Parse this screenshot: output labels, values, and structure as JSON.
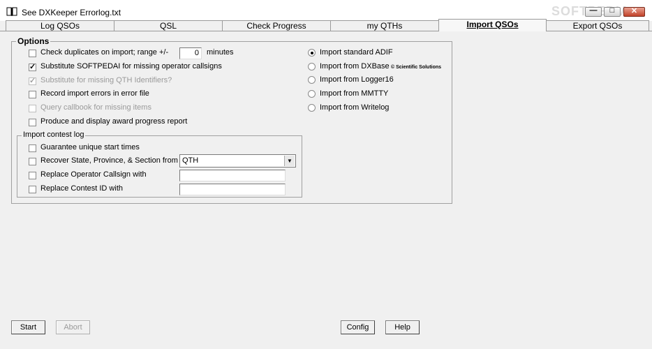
{
  "window": {
    "title": "See DXKeeper Errorlog.txt",
    "watermark": "SOFTPEDIA",
    "minimize_glyph": "—",
    "maximize_glyph": "□",
    "close_glyph": "✕"
  },
  "tabs": [
    {
      "label": "Log QSOs"
    },
    {
      "label": "QSL"
    },
    {
      "label": "Check Progress"
    },
    {
      "label": "my QTHs"
    },
    {
      "label": "Import QSOs",
      "active": true
    },
    {
      "label": "Export QSOs"
    }
  ],
  "options": {
    "legend": "Options",
    "check_duplicates": {
      "label": "Check duplicates on import; range +/-",
      "checked": false,
      "value": "0",
      "units": "minutes"
    },
    "substitute_callsign": {
      "label": "Substitute SOFTPEDAI for missing operator callsigns",
      "checked": true
    },
    "substitute_qth": {
      "label": "Substitute  for missing QTH Identifiers?",
      "checked": true,
      "disabled": true
    },
    "record_errors": {
      "label": "Record import errors in error file",
      "checked": false
    },
    "query_callbook": {
      "label": "Query callbook for missing items",
      "checked": false,
      "disabled": true
    },
    "award_progress": {
      "label": "Produce and display award progress report",
      "checked": false
    }
  },
  "import_formats": {
    "items": [
      {
        "label": "Import standard ADIF",
        "selected": true
      },
      {
        "label": "Import from DXBase",
        "selected": false
      },
      {
        "label": "Import from Logger16",
        "selected": false
      },
      {
        "label": "Import from MMTTY",
        "selected": false
      },
      {
        "label": "Import from Writelog",
        "selected": false
      }
    ],
    "dxbase_credit": "© Scientific Solutions"
  },
  "contest": {
    "legend": "Import contest log",
    "unique_times": {
      "label": "Guarantee unique start times",
      "checked": false
    },
    "recover_state": {
      "label": "Recover State, Province, & Section from",
      "checked": false,
      "selected": "QTH"
    },
    "replace_operator": {
      "label": "Replace Operator Callsign with",
      "checked": false,
      "value": ""
    },
    "replace_contest_id": {
      "label": "Replace Contest ID with",
      "checked": false,
      "value": ""
    }
  },
  "buttons": {
    "start": "Start",
    "abort": "Abort",
    "config": "Config",
    "help": "Help"
  }
}
